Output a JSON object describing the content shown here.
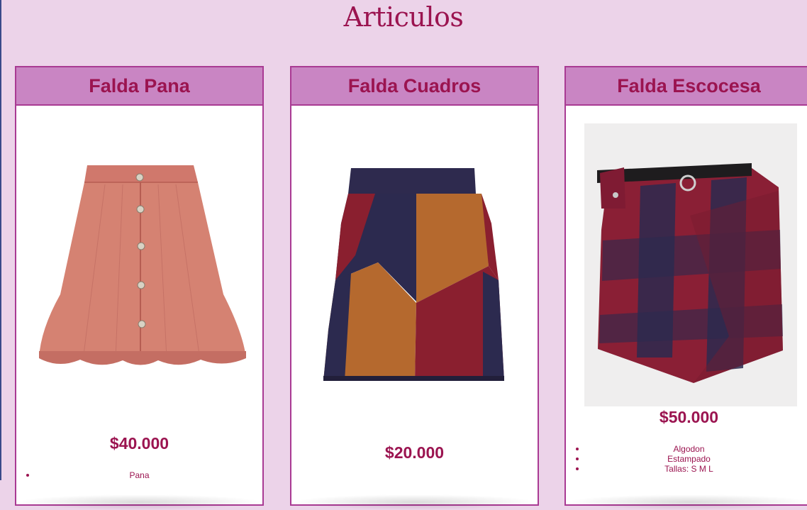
{
  "page": {
    "title": "Articulos"
  },
  "products": [
    {
      "name": "Falda Pana",
      "price": "$40.000",
      "image": "coral-button-skirt",
      "specs": [
        "Pana"
      ]
    },
    {
      "name": "Falda Cuadros",
      "price": "$20.000",
      "image": "patchwork-skirt",
      "specs": []
    },
    {
      "name": "Falda Escocesa",
      "price": "$50.000",
      "image": "plaid-belted-skirt",
      "specs": [
        "Algodon",
        "Estampado",
        "Tallas: S M L"
      ]
    }
  ],
  "colors": {
    "background": "#ecd3e9",
    "header": "#c985c3",
    "border": "#a93a93",
    "text": "#9b1450"
  }
}
